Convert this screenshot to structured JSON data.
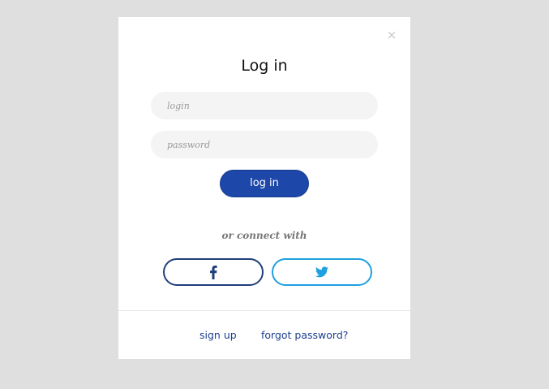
{
  "modal": {
    "close_icon": "close-icon",
    "close_glyph": "×",
    "title": "Log in",
    "login_placeholder": "login",
    "password_placeholder": "password",
    "submit_label": "log in",
    "connect_text": "or connect with",
    "social": {
      "facebook_icon": "facebook-icon",
      "twitter_icon": "twitter-icon"
    },
    "footer": {
      "signup_label": "sign up",
      "forgot_label": "forgot password?"
    }
  },
  "colors": {
    "background": "#dfdfdf",
    "primary": "#1d47a8",
    "facebook": "#1f3f7a",
    "twitter": "#1da1e0",
    "link": "#1b3f8f"
  }
}
